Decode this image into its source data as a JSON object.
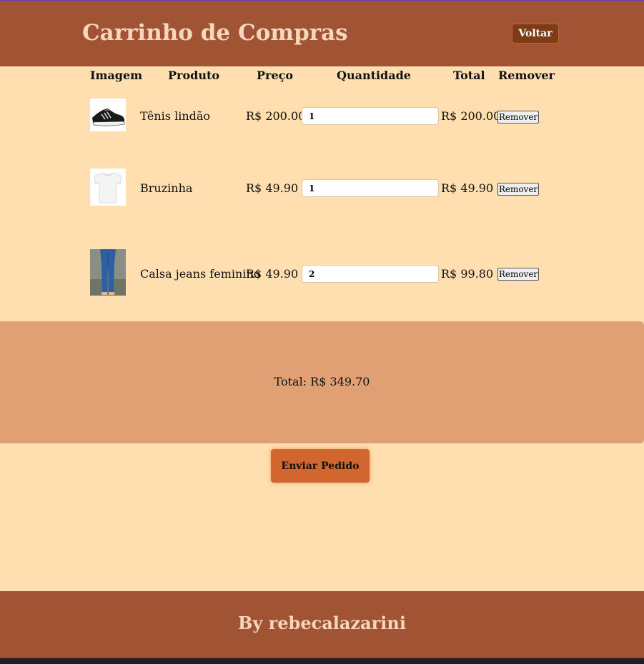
{
  "header": {
    "title": "Carrinho de Compras",
    "back_label": "Voltar"
  },
  "table": {
    "headers": [
      "Imagem",
      "Produto",
      "Preço",
      "Quantidade",
      "Total",
      "Remover"
    ],
    "rows": [
      {
        "product": "Tênis lindão",
        "price": "R$ 200.00",
        "quantity": "1",
        "total": "R$ 200.00",
        "remove_label": "Remover",
        "image_icon": "sneaker-image"
      },
      {
        "product": "Bruzinha",
        "price": "R$ 49.90",
        "quantity": "1",
        "total": "R$ 49.90",
        "remove_label": "Remover",
        "image_icon": "tshirt-image"
      },
      {
        "product": "Calsa jeans feminino",
        "price": "R$ 49.90",
        "quantity": "2",
        "total": "R$ 99.80",
        "remove_label": "Remover",
        "image_icon": "jeans-image"
      }
    ]
  },
  "summary": {
    "total_text": "Total: R$ 349.70"
  },
  "actions": {
    "send_label": "Enviar Pedido"
  },
  "footer": {
    "credit": "By rebecalazarini"
  },
  "colors": {
    "background": "#ffdfb0",
    "header": "#a05434",
    "summary": "#e0a074",
    "send_button": "#d1672e",
    "back_button": "#7d3b17"
  }
}
